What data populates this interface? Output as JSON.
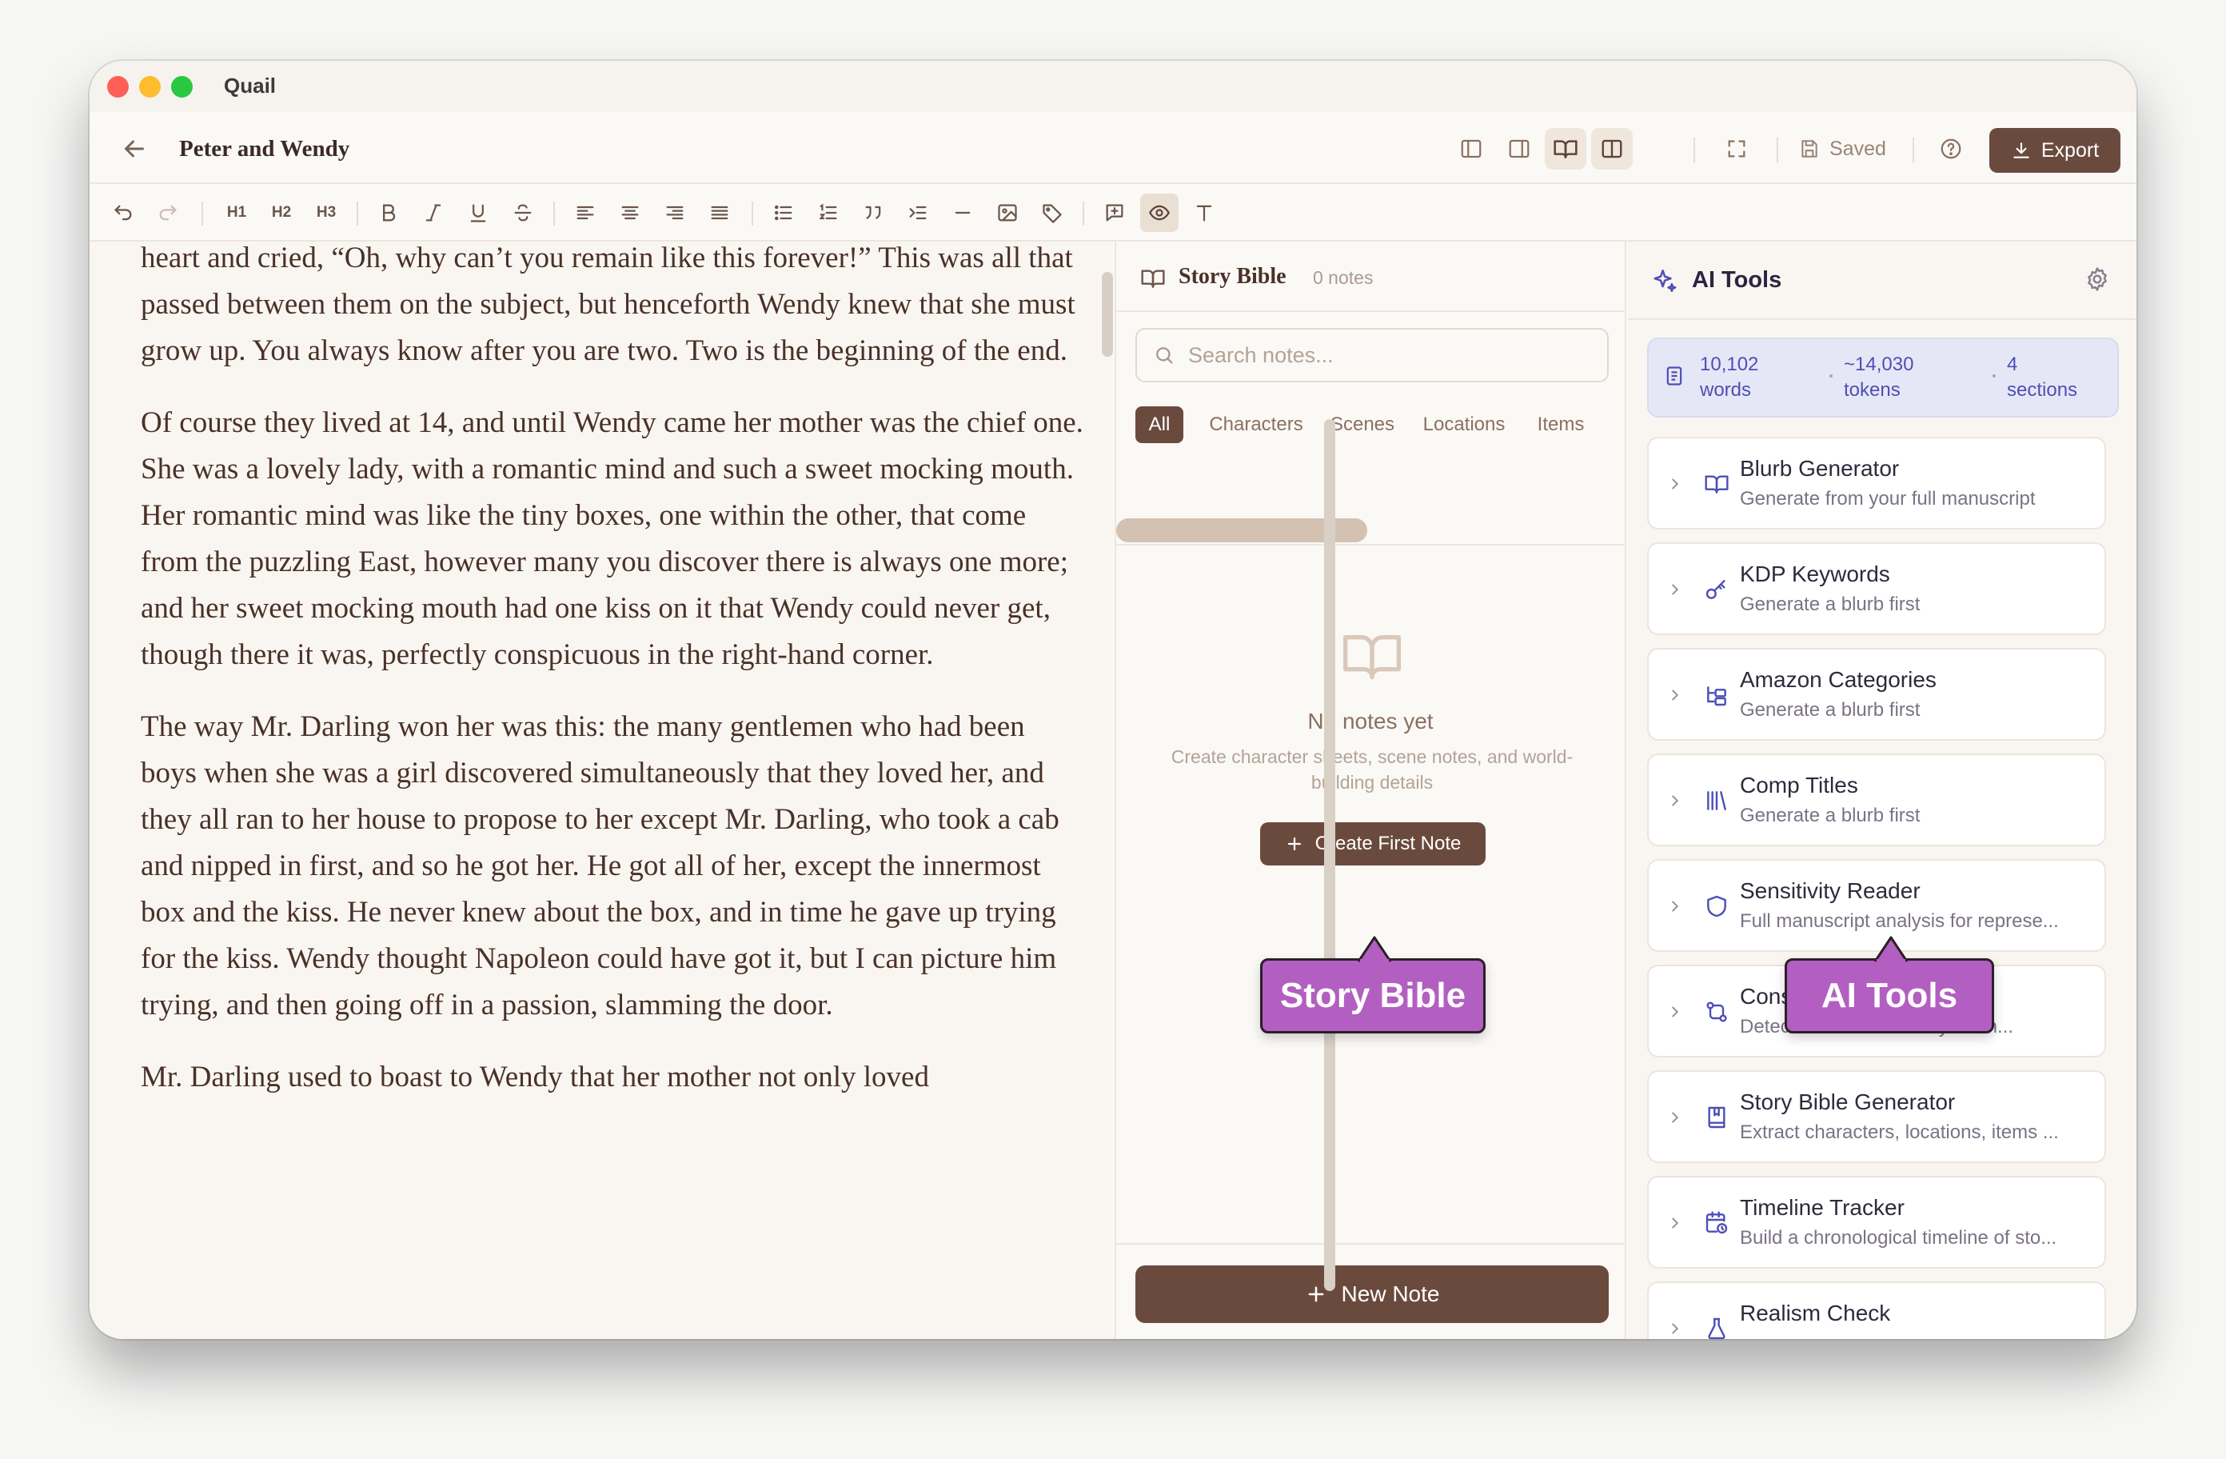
{
  "app": {
    "name": "Quail"
  },
  "header": {
    "doc_title": "Peter and Wendy",
    "saved": "Saved",
    "export": "Export"
  },
  "toolbar": {
    "h1": "H1",
    "h2": "H2",
    "h3": "H3"
  },
  "editor": {
    "paragraphs": [
      "heart and cried, “Oh, why can’t you remain like this forever!” This was all that passed between them on the subject, but henceforth Wendy knew that she must grow up. You always know after you are two. Two is the beginning of the end.",
      "Of course they lived at 14, and until Wendy came her mother was the chief one. She was a lovely lady, with a romantic mind and such a sweet mocking mouth. Her romantic mind was like the tiny boxes, one within the other, that come from the puzzling East, however many you discover there is always one more; and her sweet mocking mouth had one kiss on it that Wendy could never get, though there it was, perfectly conspicuous in the right-hand corner.",
      "The way Mr. Darling won her was this: the many gentlemen who had been boys when she was a girl discovered simultaneously that they loved her, and they all ran to her house to propose to her except Mr. Darling, who took a cab and nipped in first, and so he got her. He got all of her, except the innermost box and the kiss. He never knew about the box, and in time he gave up trying for the kiss. Wendy thought Napoleon could have got it, but I can picture him trying, and then going off in a passion, slamming the door.",
      "Mr. Darling used to boast to Wendy that her mother not only loved"
    ]
  },
  "story_bible": {
    "title": "Story Bible",
    "count": "0 notes",
    "search_placeholder": "Search notes...",
    "tabs": [
      "All",
      "Characters",
      "Scenes",
      "Locations",
      "Items"
    ],
    "empty_title": "No notes yet",
    "empty_desc": "Create character sheets, scene notes, and world-building details",
    "create_button": "Create First Note",
    "new_note": "New Note"
  },
  "ai_tools": {
    "title": "AI Tools",
    "stats": [
      {
        "value": "10,102",
        "unit": "words"
      },
      {
        "value": "~14,030",
        "unit": "tokens"
      },
      {
        "value": "4",
        "unit": "sections"
      }
    ],
    "tools": [
      {
        "name": "Blurb Generator",
        "desc": "Generate from your full manuscript",
        "icon": "book-open-icon"
      },
      {
        "name": "KDP Keywords",
        "desc": "Generate a blurb first",
        "icon": "key-icon"
      },
      {
        "name": "Amazon Categories",
        "desc": "Generate a blurb first",
        "icon": "folder-tree-icon"
      },
      {
        "name": "Comp Titles",
        "desc": "Generate a blurb first",
        "icon": "library-icon"
      },
      {
        "name": "Sensitivity Reader",
        "desc": "Full manuscript analysis for represe...",
        "icon": "shield-icon"
      },
      {
        "name": "Cons",
        "desc": "Detec",
        "desc_tail": "your m...",
        "icon": "git-compare-icon"
      },
      {
        "name": "Story Bible Generator",
        "desc": "Extract characters, locations, items ...",
        "icon": "book-marked-icon"
      },
      {
        "name": "Timeline Tracker",
        "desc": "Build a chronological timeline of sto...",
        "icon": "calendar-clock-icon"
      },
      {
        "name": "Realism Check",
        "desc": "",
        "icon": "flask-icon"
      }
    ]
  },
  "callouts": {
    "story_bible": "Story Bible",
    "ai_tools": "AI Tools"
  },
  "colors": {
    "accent_brown": "#6b4a3e",
    "ai_accent": "#4c4fb6",
    "callout": "#b25fc1",
    "canvas": "#f9f6f1"
  }
}
